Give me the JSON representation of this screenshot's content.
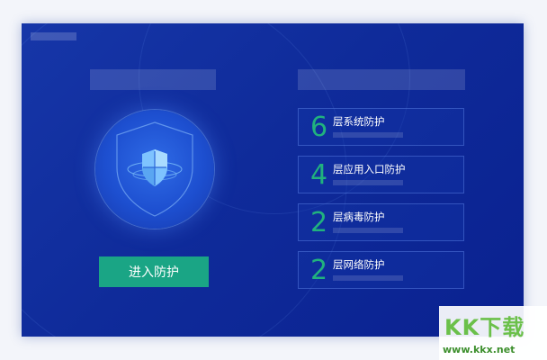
{
  "main": {
    "enter_button_label": "进入防护"
  },
  "protection_layers": [
    {
      "count": "6",
      "label": "层系统防护"
    },
    {
      "count": "4",
      "label": "层应用入口防护"
    },
    {
      "count": "2",
      "label": "层病毒防护"
    },
    {
      "count": "2",
      "label": "层网络防护"
    }
  ],
  "watermark": {
    "logo_text": "KK下载",
    "url": "www.kkx.net"
  },
  "colors": {
    "background": "#0f2b9a",
    "accent_green": "#1aa585",
    "number_green": "#21b27e"
  },
  "icons": {
    "shield": "shield-icon"
  }
}
